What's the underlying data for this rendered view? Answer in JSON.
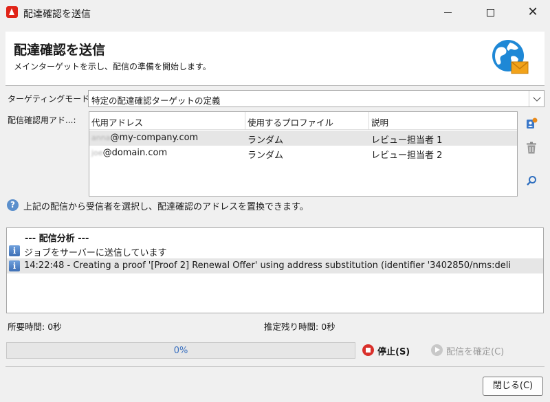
{
  "window": {
    "title": "配達確認を送信",
    "min_icon": "minimize-icon",
    "max_icon": "maximize-icon",
    "close_icon": "close-icon"
  },
  "header": {
    "title": "配達確認を送信",
    "subtitle": "メインターゲットを示し、配信の準備を開始します。",
    "icon": "globe-mail-icon"
  },
  "targeting": {
    "label": "ターゲティングモード:",
    "value": "特定の配達確認ターゲットの定義"
  },
  "addresses": {
    "label": "配信確認用アド...:",
    "columns": [
      "代用アドレス",
      "使用するプロファイル",
      "説明"
    ],
    "rows": [
      {
        "local": "anna",
        "domain": "@my-company.com",
        "profile": "ランダム",
        "description": "レビュー担当者 1",
        "selected": true
      },
      {
        "local": "joe",
        "domain": "@domain.com",
        "profile": "ランダム",
        "description": "レビュー担当者 2",
        "selected": false
      }
    ],
    "side_buttons": [
      "add-profile-icon",
      "trash-icon",
      "search-icon"
    ]
  },
  "info": {
    "icon": "help-icon",
    "text": "上記の配信から受信者を選択し、配達確認のアドレスを置換できます。"
  },
  "log": {
    "title": "--- 配信分析 ---",
    "entries": [
      {
        "icon": "info-icon",
        "text": "ジョブをサーバーに送信しています",
        "selected": false
      },
      {
        "icon": "info-icon",
        "text": "14:22:48 - Creating a proof '[Proof 2] Renewal Offer' using address substitution (identifier '3402850/nms:deli",
        "selected": true
      }
    ]
  },
  "status": {
    "elapsed_label": "所要時間:",
    "elapsed_value": "0秒",
    "remaining_label": "推定残り時間:",
    "remaining_value": "0秒"
  },
  "progress": {
    "value": 0,
    "text": "0%"
  },
  "actions": {
    "stop_label": "停止(S)",
    "confirm_label": "配信を確定(C)",
    "close_label": "閉じる(C)"
  }
}
